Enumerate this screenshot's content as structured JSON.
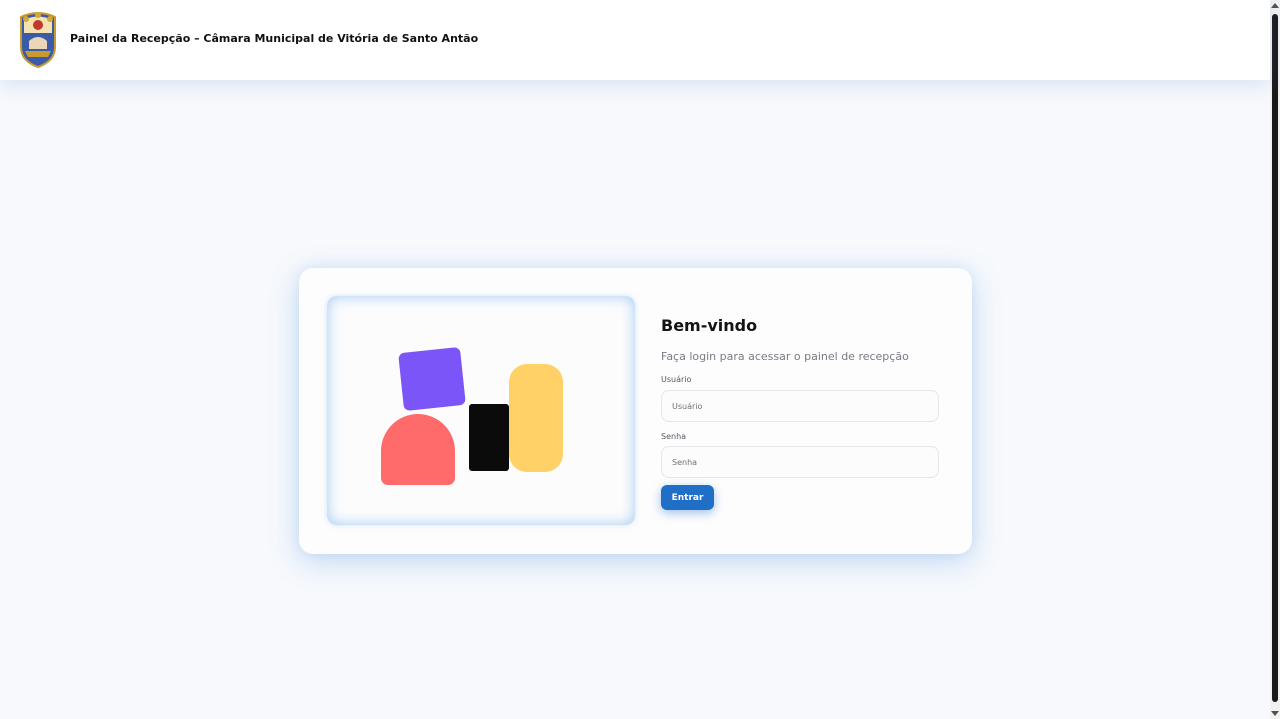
{
  "header": {
    "title": "Painel da Recepção – Câmara Municipal de Vitória de Santo Antão"
  },
  "login": {
    "heading": "Bem-vindo",
    "subtitle": "Faça login para acessar o painel de recepção",
    "username": {
      "label": "Usuário",
      "placeholder": "Usuário",
      "value": ""
    },
    "password": {
      "label": "Senha",
      "placeholder": "Senha",
      "value": ""
    },
    "submit_label": "Entrar"
  },
  "colors": {
    "accent": "#1f6fc7",
    "shape_purple": "#7b55f7",
    "shape_red": "#ff6b6b",
    "shape_black": "#0b0b0b",
    "shape_yellow": "#ffd166"
  },
  "icons": {
    "logo": "municipal-crest-icon"
  }
}
